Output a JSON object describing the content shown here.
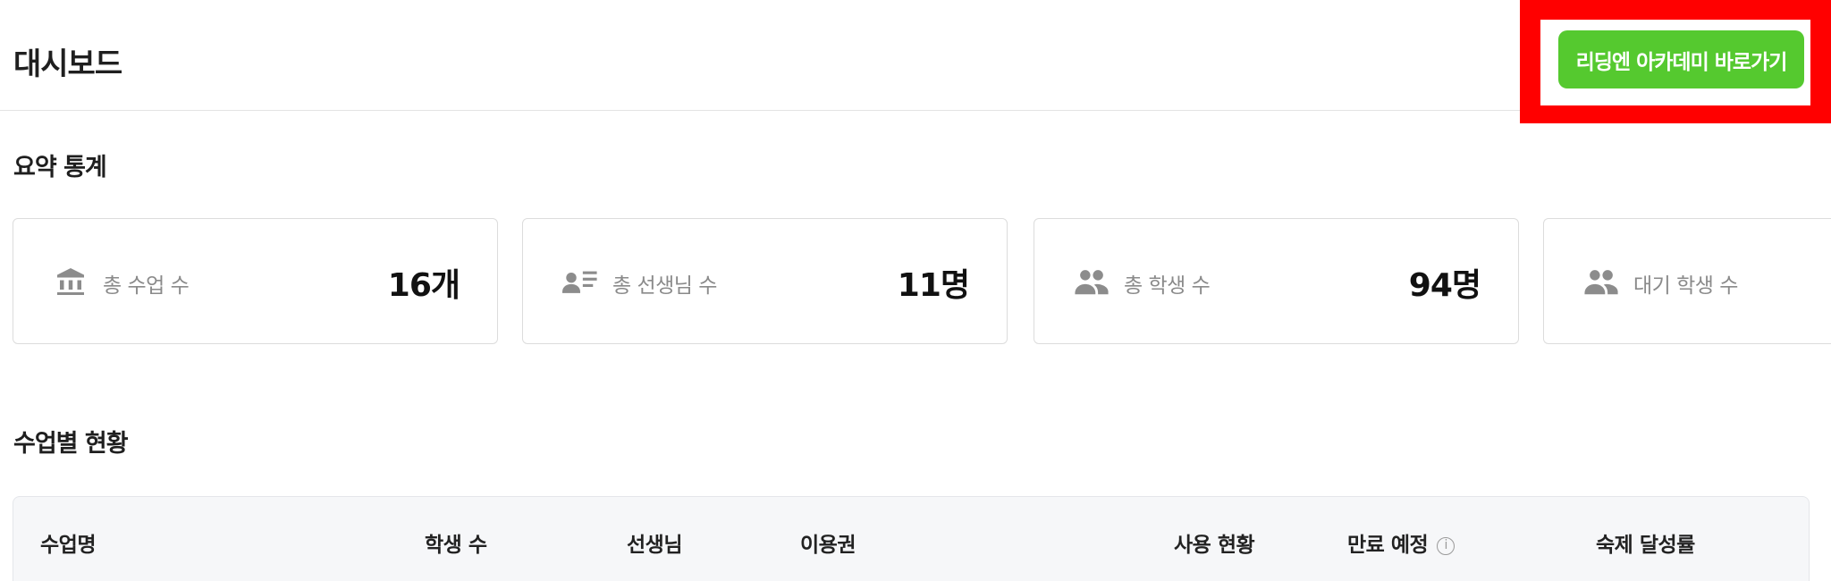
{
  "header": {
    "title": "대시보드",
    "academy_button_label": "리딩엔 아카데미 바로가기"
  },
  "summary": {
    "title": "요약 통계",
    "cards": [
      {
        "icon": "institution-icon",
        "label": "총 수업 수",
        "value": "16개"
      },
      {
        "icon": "teacher-list-icon",
        "label": "총 선생님 수",
        "value": "11명"
      },
      {
        "icon": "people-icon",
        "label": "총 학생 수",
        "value": "94명"
      },
      {
        "icon": "people-icon",
        "label": "대기 학생 수",
        "value": ""
      }
    ]
  },
  "classes": {
    "title": "수업별 현황",
    "columns": [
      "수업명",
      "학생 수",
      "선생님",
      "이용권",
      "사용 현황",
      "만료 예정",
      "숙제 달성률"
    ]
  },
  "colors": {
    "accent_green": "#55c92f",
    "highlight_red": "#ff0000",
    "icon_gray": "#8c8c8c"
  }
}
